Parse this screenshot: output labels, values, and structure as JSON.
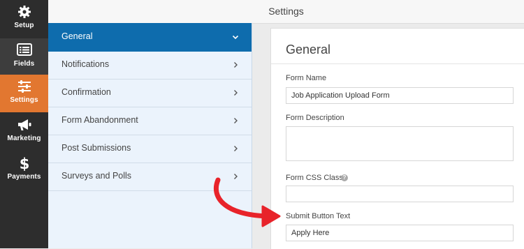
{
  "iconbar": {
    "items": [
      {
        "label": "Setup",
        "icon": "gear-icon"
      },
      {
        "label": "Fields",
        "icon": "fields-list-icon"
      },
      {
        "label": "Settings",
        "icon": "sliders-icon"
      },
      {
        "label": "Marketing",
        "icon": "megaphone-icon"
      },
      {
        "label": "Payments",
        "icon": "dollar-icon"
      }
    ],
    "active_index": 2,
    "colors": {
      "bar": "#2d2d2d",
      "active": "#e27730"
    }
  },
  "header": {
    "title": "Settings"
  },
  "subnav": {
    "items": [
      {
        "label": "General",
        "chevron": "chevron-down-icon"
      },
      {
        "label": "Notifications",
        "chevron": "chevron-right-icon"
      },
      {
        "label": "Confirmation",
        "chevron": "chevron-right-icon"
      },
      {
        "label": "Form Abandonment",
        "chevron": "chevron-right-icon"
      },
      {
        "label": "Post Submissions",
        "chevron": "chevron-right-icon"
      },
      {
        "label": "Surveys and Polls",
        "chevron": "chevron-right-icon"
      }
    ],
    "active_index": 0,
    "colors": {
      "active": "#0e6cad",
      "background": "#ebf3fc"
    }
  },
  "panel": {
    "title": "General",
    "form_name": {
      "label": "Form Name",
      "value": "Job Application Upload Form"
    },
    "form_description": {
      "label": "Form Description",
      "value": ""
    },
    "form_css_class": {
      "label": "Form CSS Class",
      "value": "",
      "help_icon": "question-circle-icon",
      "help_glyph": "?"
    },
    "submit_button_text": {
      "label": "Submit Button Text",
      "value": "Apply Here"
    }
  },
  "annotation": {
    "icon": "curved-arrow-icon",
    "color": "#e8232a"
  }
}
